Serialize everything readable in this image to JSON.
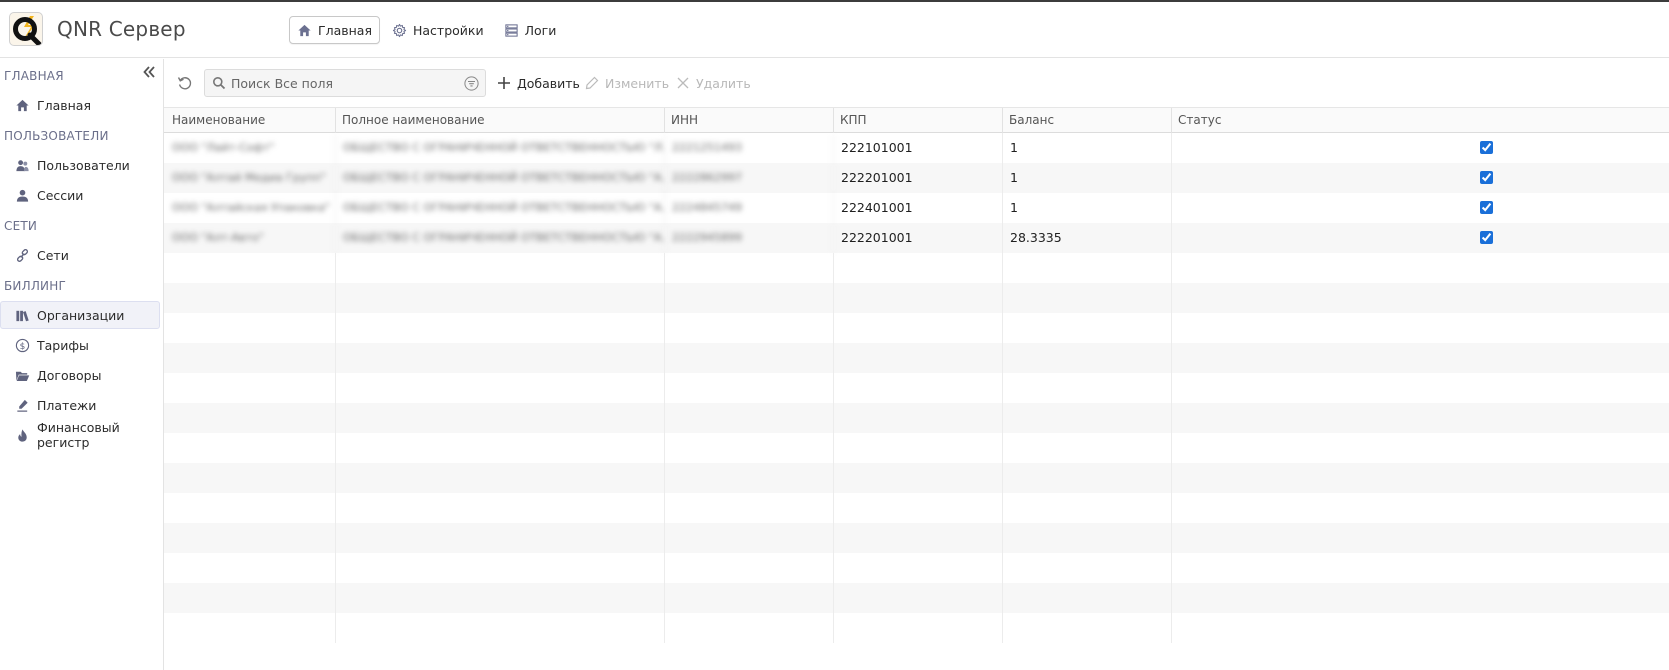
{
  "app": {
    "title": "QNR Сервер"
  },
  "topnav": [
    {
      "label": "Главная",
      "icon": "home-icon",
      "active": true
    },
    {
      "label": "Настройки",
      "icon": "gear-icon",
      "active": false
    },
    {
      "label": "Логи",
      "icon": "list-icon",
      "active": false
    }
  ],
  "sidebar": {
    "sections": [
      {
        "title": "ГЛАВНАЯ",
        "items": [
          {
            "label": "Главная",
            "icon": "home-icon"
          }
        ]
      },
      {
        "title": "ПОЛЬЗОВАТЕЛИ",
        "items": [
          {
            "label": "Пользователи",
            "icon": "users-icon"
          },
          {
            "label": "Сессии",
            "icon": "user-icon"
          }
        ]
      },
      {
        "title": "СЕТИ",
        "items": [
          {
            "label": "Сети",
            "icon": "link-icon"
          }
        ]
      },
      {
        "title": "БИЛЛИНГ",
        "items": [
          {
            "label": "Организации",
            "icon": "organizations-icon",
            "active": true
          },
          {
            "label": "Тарифы",
            "icon": "dollar-circle-icon"
          },
          {
            "label": "Договоры",
            "icon": "folder-icon"
          },
          {
            "label": "Платежи",
            "icon": "pen-icon"
          },
          {
            "label": "Финансовый регистр",
            "icon": "fire-icon"
          }
        ]
      }
    ]
  },
  "toolbar": {
    "search_placeholder": "Поиск Все поля",
    "add_label": "Добавить",
    "edit_label": "Изменить",
    "delete_label": "Удалить"
  },
  "table": {
    "columns": [
      "Наименование",
      "Полное наименование",
      "ИНН",
      "КПП",
      "Баланс",
      "Статус"
    ],
    "rows": [
      {
        "name": "ООО \"Лайт-Софт\"",
        "full_name": "ОБЩЕСТВО С ОГРАНИЧЕННОЙ ОТВЕТСТВЕННОСТЬЮ \"Л...",
        "inn": "2221251493",
        "kpp": "222101001",
        "balance": "1",
        "status": true
      },
      {
        "name": "ООО \"Алтай Медиа Групп\"",
        "full_name": "ОБЩЕСТВО С ОГРАНИЧЕННОЙ ОТВЕТСТВЕННОСТЬЮ \"А...",
        "inn": "2222862997",
        "kpp": "222201001",
        "balance": "1",
        "status": true
      },
      {
        "name": "ООО \"Алтайская Упаковка\"",
        "full_name": "ОБЩЕСТВО С ОГРАНИЧЕННОЙ ОТВЕТСТВЕННОСТЬЮ \"А...",
        "inn": "2224845749",
        "kpp": "222401001",
        "balance": "1",
        "status": true
      },
      {
        "name": "ООО \"Алт-Авто\"",
        "full_name": "ОБЩЕСТВО С ОГРАНИЧЕННОЙ ОТВЕТСТВЕННОСТЬЮ \"А...",
        "inn": "2222945899",
        "kpp": "222201001",
        "balance": "28.3335",
        "status": true
      }
    ],
    "empty_rows": 13
  },
  "colors": {
    "accent": "#1a6fd8",
    "text": "#2b2b2b",
    "section": "#6b6f8a",
    "disabled": "#b8b8b8"
  }
}
